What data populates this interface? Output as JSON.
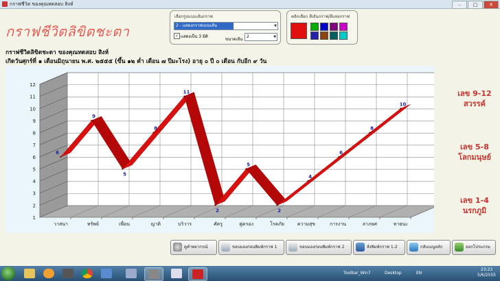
{
  "window": {
    "title": "กราฟชีวิต ของคุณทดสอบ สิงห์"
  },
  "app_title": "กราฟชีวิตลิขิตชะตา",
  "graph_type_group": {
    "label": "เลือกรูปแบบเส้นกราฟ",
    "selected": "2 - แสดงกราฟแบบเส้น",
    "checkbox_label": "แสดงเป็น 3 มิติ",
    "checkbox_checked": true,
    "line_size_label": "ขนาดเส้น",
    "line_size_value": "2"
  },
  "color_group": {
    "label": "คลิกเลือก สีเส้นกราฟ/สีแท่งกราฟ",
    "selected_color": "#e01010",
    "swatches": [
      "#00b000",
      "#0000cc",
      "#800080",
      "#cc00cc",
      "#2222aa",
      "#8b4513",
      "#006060",
      "#00cccc"
    ]
  },
  "header": {
    "line1": "กราฟชีวิตลิขิตชะตา ของคุณทดสอบ สิงห์",
    "line2": "เกิดวันศุกร์ที่ ๑ เดือนมิถุนายน  พ.ศ. ๒๕๕๕  (ขึ้น ๑๒ ค่ำ  เดือน ๗ ปีมะโรง)  อายุ ๐  ปี ๐ เดือน กับอีก ๙ วัน"
  },
  "chart_data": {
    "type": "line",
    "three_d": true,
    "categories": [
      "วาสนา",
      "ทรัพย์",
      "เพื่อน",
      "ญาติ",
      "บริวาร",
      "ศัตรู",
      "คู่ครอง",
      "โรคภัย",
      "ความสุข",
      "การงาน",
      "ลาภยศ",
      "หายนะ"
    ],
    "values": [
      6,
      9,
      5,
      8,
      11,
      2,
      5,
      2,
      4,
      6,
      8,
      10
    ],
    "ylim": [
      1,
      12
    ],
    "yticks": [
      "1",
      "2",
      "3",
      "4",
      "5",
      "6",
      "7",
      "8",
      "9",
      "10",
      "11",
      "12"
    ],
    "grid": true,
    "line_color": "#cc0000"
  },
  "side_labels": [
    {
      "line1": "เลข 9-12",
      "line2": "สวรรค์"
    },
    {
      "line1": "เลข 5-8",
      "line2": "โลกมนุษย์"
    },
    {
      "line1": "เลข 1-4",
      "line2": "นรกภูมิ"
    }
  ],
  "buttons": [
    {
      "label": "ดูคำพยากรณ์",
      "icon": "forecast-icon"
    },
    {
      "label": "ขอบมองก่อนพิมพ์กราฟ 1",
      "icon": "preview-icon"
    },
    {
      "label": "ขอบมองก่อนพิมพ์กราฟ 2",
      "icon": "preview-icon"
    },
    {
      "label": "สั่งพิมพ์กราฟ 1-2",
      "icon": "print-icon"
    },
    {
      "label": "กลับเมนูหลัก",
      "icon": "home-icon"
    },
    {
      "label": "ออกโปรแกรม",
      "icon": "exit-icon"
    }
  ],
  "taskbar": {
    "toolbar_label": "Toolbar_Win7",
    "desktop_label": "Desktop",
    "lang": "EN",
    "time": "23:23",
    "date": "5/6/2555"
  }
}
